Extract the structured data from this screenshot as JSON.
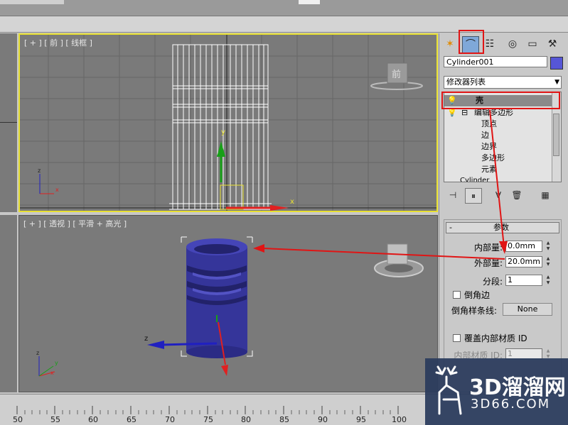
{
  "viewports": {
    "front_label": "[ + ] [ 前 ] [ 线框 ]",
    "persp_label": "[ + ] [ 透视 ] [ 平滑 + 高光 ]",
    "viewcube_front": "前",
    "axis_x": "x",
    "axis_y": "y",
    "axis_z": "z"
  },
  "panel": {
    "tab_icons": [
      "create-icon",
      "modify-icon",
      "hierarchy-icon",
      "motion-icon",
      "display-icon",
      "utilities-icon"
    ],
    "object_name": "Cylinder001",
    "object_color": "#5656d6",
    "modifier_list": "修改器列表",
    "stack": {
      "shell": "壳",
      "edit_poly": "编辑多边形",
      "sub_vertex": "顶点",
      "sub_edge": "边",
      "sub_border": "边界",
      "sub_poly": "多边形",
      "sub_element": "元素",
      "base": "Cylinder"
    },
    "params": {
      "title": "参数",
      "inner_label": "内部量:",
      "inner_value": "0.0mm",
      "outer_label": "外部量:",
      "outer_value": "20.0mm",
      "segments_label": "分段:",
      "segments_value": "1",
      "bevel_edges": "倒角边",
      "bevel_spline_label": "倒角样条线:",
      "bevel_spline_value": "None",
      "override_inner": "覆盖内部材质 ID",
      "inner_mat_label": "内部材质 ID:",
      "inner_mat_value": "1"
    }
  },
  "ruler": {
    "ticks": [
      "50",
      "55",
      "60",
      "65",
      "70",
      "75",
      "80",
      "85",
      "90",
      "95",
      "100"
    ]
  },
  "watermark": {
    "title": "3D溜溜网",
    "sub": "3D66.COM"
  }
}
